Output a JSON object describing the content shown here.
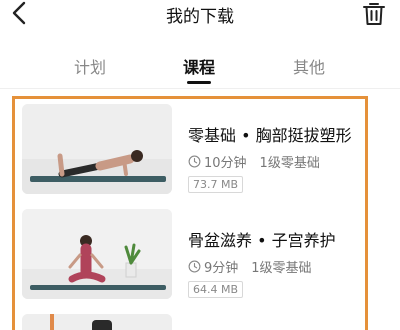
{
  "header": {
    "title": "我的下载",
    "back_icon": "chevron-left-icon",
    "trash_icon": "trash-icon"
  },
  "tabs": [
    {
      "label": "计划",
      "active": false
    },
    {
      "label": "课程",
      "active": true
    },
    {
      "label": "其他",
      "active": false
    }
  ],
  "courses": [
    {
      "title": "零基础 • 胸部挺拔塑形",
      "duration": "10分钟",
      "level": "1级零基础",
      "size": "73.7 MB"
    },
    {
      "title": "骨盆滋养 • 子宫养护",
      "duration": "9分钟",
      "level": "1级零基础",
      "size": "64.4 MB"
    }
  ],
  "colors": {
    "highlight": "#e5913a",
    "text": "#111111",
    "muted": "#888888",
    "mat": "#3d5d63"
  }
}
